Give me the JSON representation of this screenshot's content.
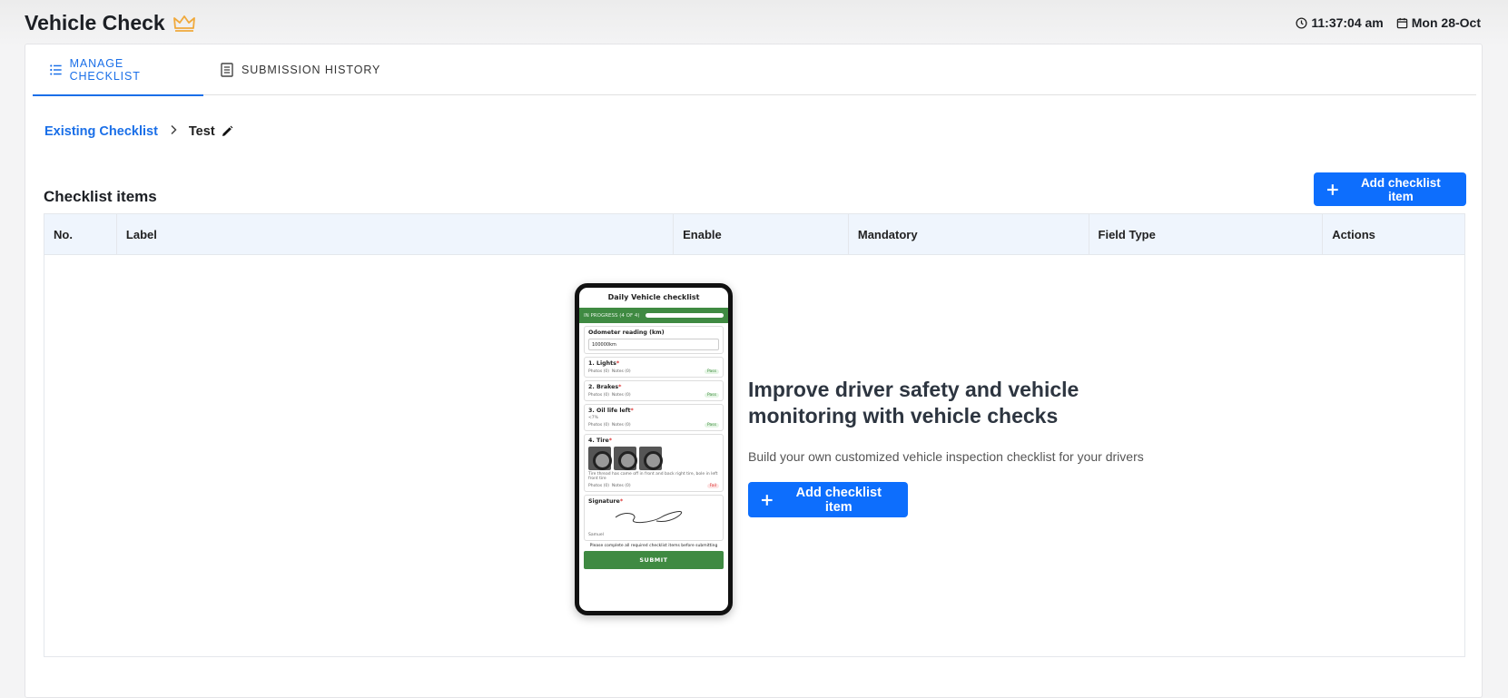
{
  "header": {
    "title": "Vehicle Check",
    "time": "11:37:04 am",
    "date": "Mon 28-Oct"
  },
  "tabs": [
    {
      "label": "MANAGE CHECKLIST",
      "active": true,
      "icon": "list-icon"
    },
    {
      "label": "SUBMISSION HISTORY",
      "active": false,
      "icon": "document-icon"
    }
  ],
  "breadcrumb": {
    "parent": "Existing Checklist",
    "current": "Test"
  },
  "section": {
    "title": "Checklist items",
    "add_button": "Add checklist item"
  },
  "table": {
    "columns": [
      "No.",
      "Label",
      "Enable",
      "Mandatory",
      "Field Type",
      "Actions"
    ]
  },
  "empty_state": {
    "title": "Improve driver safety and vehicle monitoring with vehicle checks",
    "subtitle": "Build your own customized vehicle inspection checklist for your drivers",
    "button": "Add checklist item"
  },
  "phone": {
    "title": "Daily Vehicle checklist",
    "progress": "IN PROGRESS (4 OF 4)",
    "odometer_label": "Odometer reading (km)",
    "odometer_value": "100000km",
    "items": [
      {
        "label": "1. Lights",
        "status": "Pass"
      },
      {
        "label": "2. Brakes",
        "status": "Pass"
      },
      {
        "label": "3. Oil life left",
        "value": "<7%",
        "status": "Pass"
      },
      {
        "label": "4. Tire",
        "note": "Tire thread has came off in front and back right tire, bole in left front tire",
        "status": "Fail"
      }
    ],
    "photos_label": "Photos (0)",
    "notes_label": "Notes (0)",
    "signature_label": "Signature",
    "signer": "Samuel",
    "footer_note": "Please complete all required checklist items before submitting",
    "submit": "SUBMIT"
  },
  "colors": {
    "accent": "#1a6fe8",
    "primary_button": "#0d6efd",
    "crown": "#f0a93b",
    "phone_green": "#3f8a42"
  }
}
